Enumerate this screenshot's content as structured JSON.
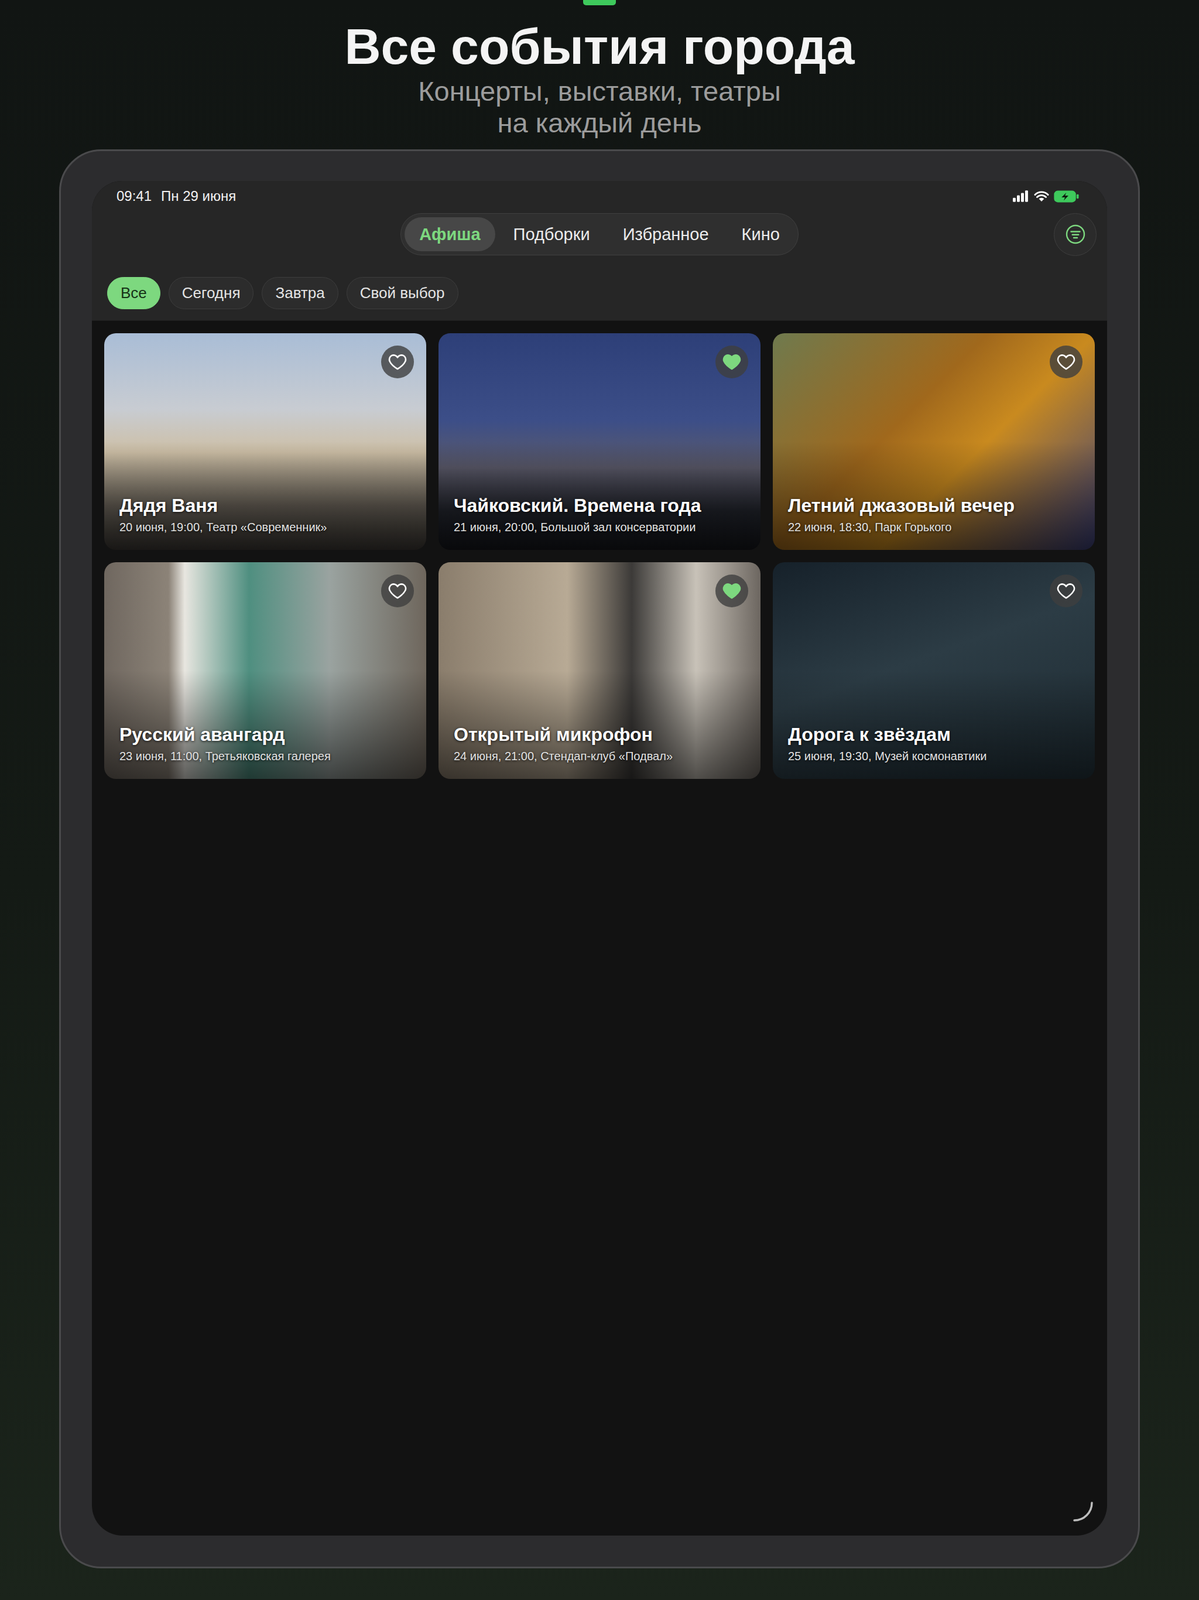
{
  "hero": {
    "title": "Все события города",
    "subtitle_lines": [
      "Концерты, выставки, театры",
      "на каждый день"
    ]
  },
  "status_bar": {
    "time": "09:41",
    "date": "Пн 29 июня"
  },
  "tabs": [
    {
      "label": "Афиша",
      "selected": true
    },
    {
      "label": "Подборки",
      "selected": false
    },
    {
      "label": "Избранное",
      "selected": false
    },
    {
      "label": "Кино",
      "selected": false
    }
  ],
  "filters": [
    {
      "label": "Все",
      "selected": true
    },
    {
      "label": "Сегодня",
      "selected": false
    },
    {
      "label": "Завтра",
      "selected": false
    },
    {
      "label": "Свой выбор",
      "selected": false
    }
  ],
  "events": [
    {
      "title": "Дядя Ваня",
      "details": "20 июня, 19:00, Театр «Современник»",
      "favorite": false
    },
    {
      "title": "Чайковский. Времена года",
      "details": "21 июня, 20:00, Большой зал консерватории",
      "favorite": true
    },
    {
      "title": "Летний джазовый вечер",
      "details": "22 июня, 18:30, Парк Горького",
      "favorite": false
    },
    {
      "title": "Русский авангард",
      "details": "23 июня, 11:00, Третьяковская галерея",
      "favorite": false
    },
    {
      "title": "Открытый микрофон",
      "details": "24 июня, 21:00, Стендап-клуб «Подвал»",
      "favorite": true
    },
    {
      "title": "Дорога к звёздам",
      "details": "25 июня, 19:30, Музей космонавтики",
      "favorite": false
    }
  ]
}
